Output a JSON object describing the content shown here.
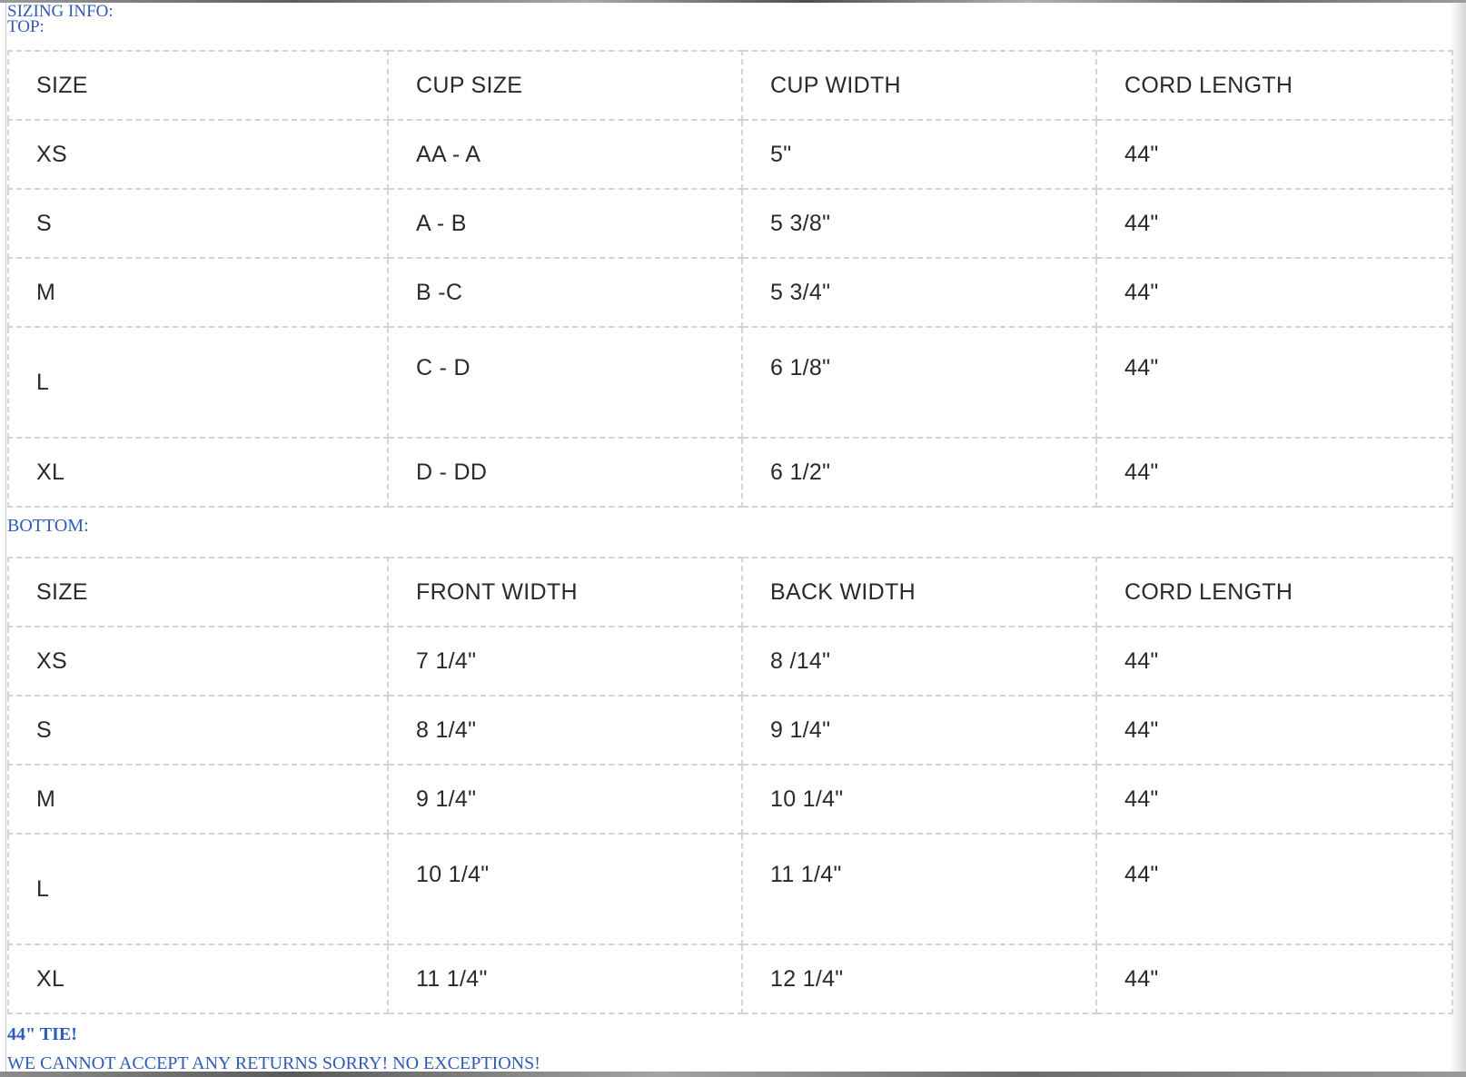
{
  "labels": {
    "sizing_info": "SIZING INFO:",
    "top": "TOP:",
    "bottom": "BOTTOM:",
    "tie_note": "44\" TIE!",
    "returns_note": "WE CANNOT ACCEPT ANY RETURNS SORRY! NO EXCEPTIONS!"
  },
  "top_table": {
    "headers": [
      "SIZE",
      "CUP SIZE",
      "CUP WIDTH",
      "CORD LENGTH"
    ],
    "rows": [
      [
        "XS",
        "AA - A",
        "5\"",
        "44\""
      ],
      [
        "S",
        "A - B",
        "5 3/8\"",
        "44\""
      ],
      [
        "M",
        "B -C",
        "5 3/4\"",
        "44\""
      ],
      [
        "L",
        "C - D",
        "6 1/8\"",
        "44\""
      ],
      [
        "XL",
        "D - DD",
        "6 1/2\"",
        "44\""
      ]
    ]
  },
  "bottom_table": {
    "headers": [
      "SIZE",
      "FRONT WIDTH",
      "BACK WIDTH",
      "CORD LENGTH"
    ],
    "rows": [
      [
        "XS",
        "7 1/4\"",
        "8 /14\"",
        "44\""
      ],
      [
        "S",
        "8 1/4\"",
        "9 1/4\"",
        "44\""
      ],
      [
        "M",
        "9 1/4\"",
        "10 1/4\"",
        "44\""
      ],
      [
        "L",
        "10 1/4\"",
        "11 1/4\"",
        "44\""
      ],
      [
        "XL",
        "11 1/4\"",
        "12 1/4\"",
        "44\""
      ]
    ]
  },
  "colors": {
    "label_blue": "#2d5bb5",
    "table_text": "#2a2a2a",
    "border_dashed": "#d4d4d4"
  }
}
